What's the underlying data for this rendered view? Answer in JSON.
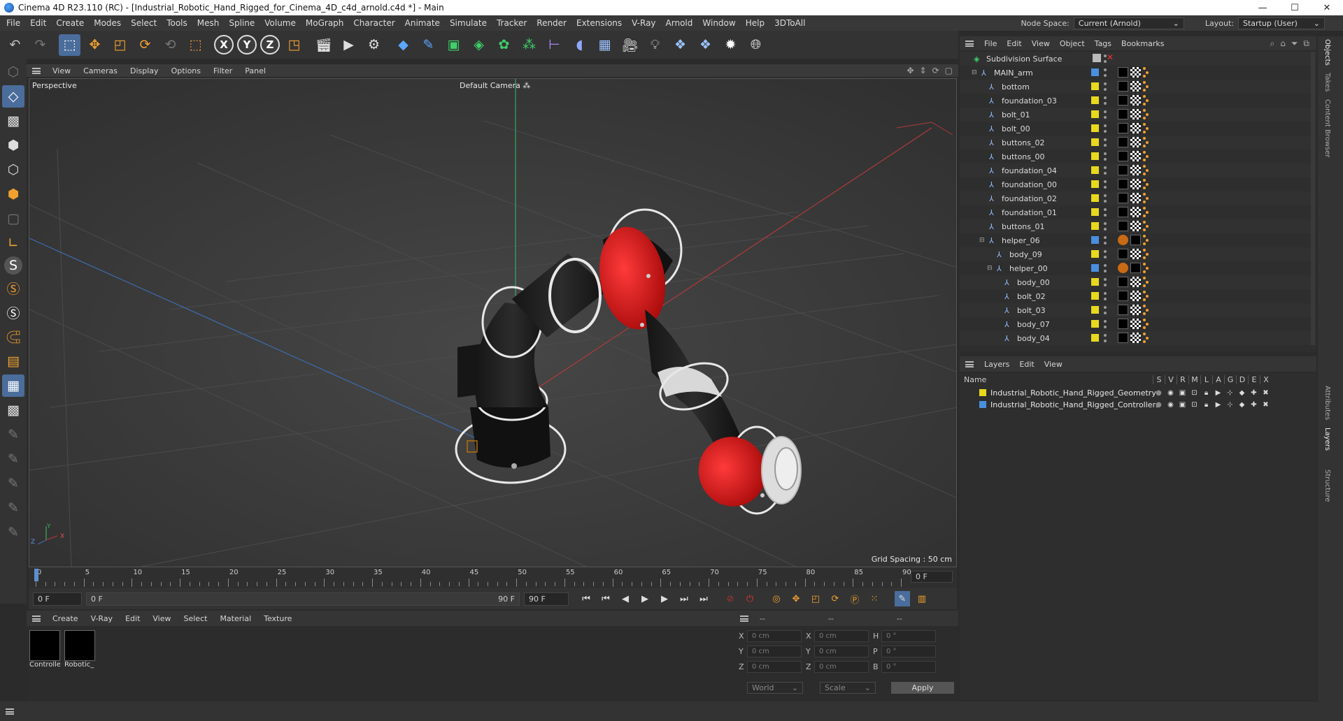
{
  "window": {
    "title": "Cinema 4D R23.110 (RC) - [Industrial_Robotic_Hand_Rigged_for_Cinema_4D_c4d_arnold.c4d *] - Main",
    "minimize": "—",
    "maximize": "☐",
    "close": "✕"
  },
  "menubar": {
    "items": [
      "File",
      "Edit",
      "Create",
      "Modes",
      "Select",
      "Tools",
      "Mesh",
      "Spline",
      "Volume",
      "MoGraph",
      "Character",
      "Animate",
      "Simulate",
      "Tracker",
      "Render",
      "Extensions",
      "V-Ray",
      "Arnold",
      "Window",
      "Help",
      "3DToAll"
    ],
    "node_space_label": "Node Space:",
    "node_space_value": "Current (Arnold)",
    "layout_label": "Layout:",
    "layout_value": "Startup (User)"
  },
  "toolbar_icons": [
    "undo-icon",
    "redo-icon",
    "live-select-icon",
    "move-icon",
    "scale-icon",
    "rotate-icon",
    "recent-tool-icon",
    "selection-icon",
    "x-axis-icon",
    "y-axis-icon",
    "z-axis-icon",
    "coord-system-icon",
    "render-view-icon",
    "render-picture-viewer-icon",
    "render-settings-icon",
    "cube-icon",
    "pen-icon",
    "subdivision-icon",
    "extrude-icon",
    "cloner-icon",
    "array-icon",
    "symmetry-icon",
    "deformer-icon",
    "floor-icon",
    "camera-icon",
    "light-icon",
    "python-icon",
    "python2-icon",
    "gear-icon",
    "sphere-grid-icon"
  ],
  "viewport": {
    "menu": [
      "View",
      "Cameras",
      "Display",
      "Options",
      "Filter",
      "Panel"
    ],
    "label": "Perspective",
    "camera": "Default Camera",
    "grid_spacing": "Grid Spacing : 50 cm",
    "axis_x": "X",
    "axis_y": "Y",
    "axis_z": "Z"
  },
  "timeline": {
    "ticks": [
      "0",
      "5",
      "10",
      "15",
      "20",
      "25",
      "30",
      "35",
      "40",
      "45",
      "50",
      "55",
      "60",
      "65",
      "70",
      "75",
      "80",
      "85",
      "90"
    ],
    "current_frame": "0 F"
  },
  "transport": {
    "start": "0 F",
    "range_start": "0 F",
    "range_end": "90 F",
    "end": "90 F"
  },
  "material_menu": [
    "Create",
    "V-Ray",
    "Edit",
    "View",
    "Select",
    "Material",
    "Texture"
  ],
  "materials": [
    {
      "name": "Controlle"
    },
    {
      "name": "Robotic_"
    }
  ],
  "coords": {
    "header": [
      "--",
      "--",
      "--"
    ],
    "rows": [
      {
        "l1": "X",
        "v1": "0 cm",
        "l2": "X",
        "v2": "0 cm",
        "l3": "H",
        "v3": "0 °"
      },
      {
        "l1": "Y",
        "v1": "0 cm",
        "l2": "Y",
        "v2": "0 cm",
        "l3": "P",
        "v3": "0 °"
      },
      {
        "l1": "Z",
        "v1": "0 cm",
        "l2": "Z",
        "v2": "0 cm",
        "l3": "B",
        "v3": "0 °"
      }
    ],
    "mode1": "World",
    "mode2": "Scale",
    "apply": "Apply"
  },
  "object_menu": [
    "File",
    "Edit",
    "View",
    "Object",
    "Tags",
    "Bookmarks"
  ],
  "objects": [
    {
      "name": "Subdivision Surface",
      "indent": 0,
      "dot": "",
      "tag": "edit"
    },
    {
      "name": "MAIN_arm",
      "indent": 1,
      "dot": "#4a8ee0",
      "tag": "black"
    },
    {
      "name": "bottom",
      "indent": 2,
      "dot": "#e8d81e",
      "tag": "black"
    },
    {
      "name": "foundation_03",
      "indent": 2,
      "dot": "#e8d81e",
      "tag": "black"
    },
    {
      "name": "bolt_01",
      "indent": 2,
      "dot": "#e8d81e",
      "tag": "black"
    },
    {
      "name": "bolt_00",
      "indent": 2,
      "dot": "#e8d81e",
      "tag": "black"
    },
    {
      "name": "buttons_02",
      "indent": 2,
      "dot": "#e8d81e",
      "tag": "black"
    },
    {
      "name": "buttons_00",
      "indent": 2,
      "dot": "#e8d81e",
      "tag": "black"
    },
    {
      "name": "foundation_04",
      "indent": 2,
      "dot": "#e8d81e",
      "tag": "black"
    },
    {
      "name": "foundation_00",
      "indent": 2,
      "dot": "#e8d81e",
      "tag": "black"
    },
    {
      "name": "foundation_02",
      "indent": 2,
      "dot": "#e8d81e",
      "tag": "black"
    },
    {
      "name": "foundation_01",
      "indent": 2,
      "dot": "#e8d81e",
      "tag": "black"
    },
    {
      "name": "buttons_01",
      "indent": 2,
      "dot": "#e8d81e",
      "tag": "black"
    },
    {
      "name": "helper_06",
      "indent": 2,
      "dot": "#4a8ee0",
      "tag": "orange"
    },
    {
      "name": "body_09",
      "indent": 3,
      "dot": "#e8d81e",
      "tag": "black"
    },
    {
      "name": "helper_00",
      "indent": 3,
      "dot": "#4a8ee0",
      "tag": "orange"
    },
    {
      "name": "body_00",
      "indent": 4,
      "dot": "#e8d81e",
      "tag": "black"
    },
    {
      "name": "bolt_02",
      "indent": 4,
      "dot": "#e8d81e",
      "tag": "black"
    },
    {
      "name": "bolt_03",
      "indent": 4,
      "dot": "#e8d81e",
      "tag": "black"
    },
    {
      "name": "body_07",
      "indent": 4,
      "dot": "#e8d81e",
      "tag": "black"
    },
    {
      "name": "body_04",
      "indent": 4,
      "dot": "#e8d81e",
      "tag": "black"
    }
  ],
  "layer_menu": [
    "Layers",
    "Edit",
    "View"
  ],
  "layer_header": {
    "name": "Name",
    "cols": [
      "S",
      "V",
      "R",
      "M",
      "L",
      "A",
      "G",
      "D",
      "E",
      "X"
    ]
  },
  "layers": [
    {
      "name": "Industrial_Robotic_Hand_Rigged_Geometry",
      "color": "#e8d81e"
    },
    {
      "name": "Industrial_Robotic_Hand_Rigged_Controllers",
      "color": "#4a8ee0"
    }
  ],
  "side_tabs": [
    "Objects",
    "Takes",
    "Content Browser",
    "Attributes",
    "Layers",
    "Structure"
  ]
}
